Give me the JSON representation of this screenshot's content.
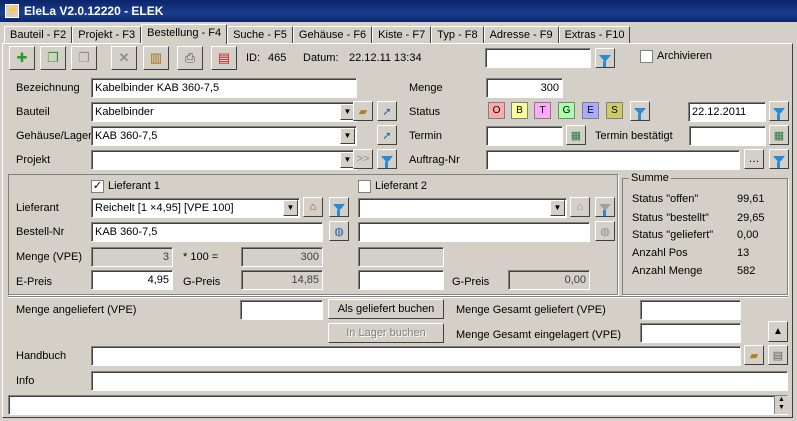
{
  "window": {
    "title": "EleLa V2.0.12220  -  ELEK"
  },
  "tabs": [
    "Bauteil - F2",
    "Projekt - F3",
    "Bestellung - F4",
    "Suche - F5",
    "Gehäuse - F6",
    "Kiste - F7",
    "Typ - F8",
    "Adresse - F9",
    "Extras - F10"
  ],
  "header": {
    "id_label": "ID:",
    "id_value": "465",
    "datum_label": "Datum:",
    "datum_value": "22.12.11 13:34",
    "search_value": "",
    "archive_label": "Archivieren"
  },
  "form": {
    "bezeichnung_label": "Bezeichnung",
    "bezeichnung_value": "Kabelbinder KAB 360-7,5",
    "bauteil_label": "Bauteil",
    "bauteil_value": "Kabelbinder",
    "gehaeuse_label": "Gehäuse/Lager",
    "gehaeuse_value": "KAB 360-7,5",
    "projekt_label": "Projekt",
    "projekt_value": "",
    "menge_label": "Menge",
    "menge_value": "300",
    "status_label": "Status",
    "status_buttons": [
      {
        "label": "O",
        "color": "#ffaaaa"
      },
      {
        "label": "B",
        "color": "#ffff99"
      },
      {
        "label": "T",
        "color": "#ffaaff"
      },
      {
        "label": "G",
        "color": "#aaffaa"
      },
      {
        "label": "E",
        "color": "#aaaaff"
      },
      {
        "label": "S",
        "color": "#cccc66"
      }
    ],
    "status_date": "22.12.2011",
    "termin_label": "Termin",
    "termin_value": "",
    "termin_best_label": "Termin bestätigt",
    "termin_best_value": "",
    "auftrag_label": "Auftrag-Nr",
    "auftrag_value": "",
    "projekt_arrow": ">>"
  },
  "supplier": {
    "l1_label": "Lieferant 1",
    "l1_checked": true,
    "l2_label": "Lieferant 2",
    "l2_checked": false,
    "lieferant_label": "Lieferant",
    "lieferant1_value": "Reichelt [1 ×4,95] [VPE 100]",
    "lieferant2_value": "",
    "bestellnr_label": "Bestell-Nr",
    "bestellnr1_value": "KAB 360-7,5",
    "bestellnr2_value": "",
    "menge_vpe_label": "Menge (VPE)",
    "menge_vpe1_value": "3",
    "mult_label": "* 100 =",
    "menge_total_value": "300",
    "menge_vpe2_value": "",
    "epreis_label": "E-Preis",
    "epreis1_value": "4,95",
    "gpreis_label": "G-Preis",
    "gpreis1_value": "14,85",
    "epreis2_value": "",
    "gpreis2_label": "G-Preis",
    "gpreis2_value": "0,00"
  },
  "summe": {
    "title": "Summe",
    "rows": [
      {
        "label": "Status \"offen\"",
        "value": "99,61"
      },
      {
        "label": "Status \"bestellt\"",
        "value": "29,65"
      },
      {
        "label": "Status \"geliefert\"",
        "value": "0,00"
      },
      {
        "label": "Anzahl Pos",
        "value": "13"
      },
      {
        "label": "Anzahl Menge",
        "value": "582"
      }
    ]
  },
  "bottom": {
    "angeliefert_label": "Menge angeliefert (VPE)",
    "angeliefert_value": "",
    "geliefert_btn": "Als geliefert buchen",
    "lager_btn": "In Lager buchen",
    "gesamt_geliefert_label": "Menge Gesamt geliefert (VPE)",
    "gesamt_geliefert_value": "",
    "gesamt_lager_label": "Menge Gesamt eingelagert (VPE)",
    "gesamt_lager_value": "",
    "handbuch_label": "Handbuch",
    "handbuch_value": "",
    "info_label": "Info",
    "info_value": "",
    "status_text": ""
  }
}
